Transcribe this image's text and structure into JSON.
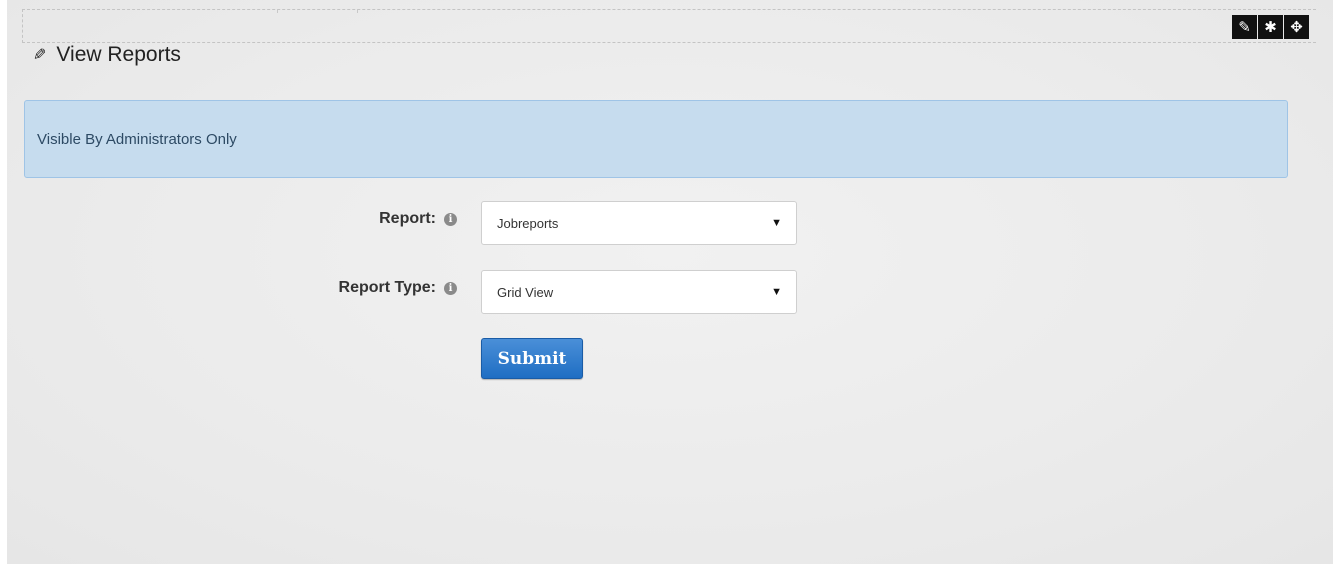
{
  "widget": {
    "toolbar": {
      "edit_icon": "pencil-icon",
      "settings_icon": "gear-icon",
      "move_icon": "move-icon"
    }
  },
  "header": {
    "title": "View Reports",
    "icon": "pencil-icon"
  },
  "alert": {
    "text": "Visible By Administrators Only",
    "color": "#c6dcee"
  },
  "form": {
    "report": {
      "label": "Report:",
      "value": "Jobreports"
    },
    "report_type": {
      "label": "Report Type:",
      "value": "Grid View"
    },
    "submit_label": "Submit"
  },
  "colors": {
    "accent": "#1f6ec3",
    "alert_border": "#9fc4e6"
  }
}
